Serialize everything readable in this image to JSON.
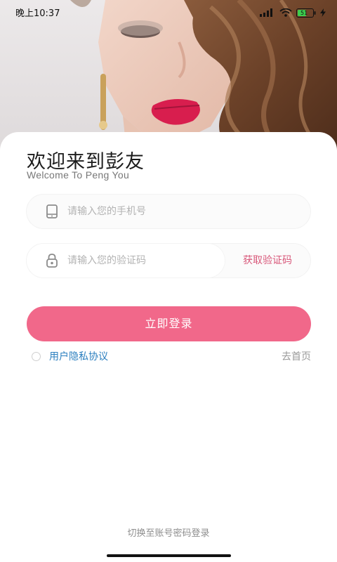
{
  "status_bar": {
    "time": "晚上10:37",
    "battery_level": "51",
    "icons": [
      "signal-icon",
      "wifi-icon",
      "battery-icon",
      "charging-icon"
    ]
  },
  "hero": {
    "image": "portrait-photo"
  },
  "welcome": {
    "title": "欢迎来到彭友",
    "subtitle": "Welcome To Peng You"
  },
  "form": {
    "phone": {
      "icon": "phone-icon",
      "value": "",
      "placeholder": "请输入您的手机号"
    },
    "code": {
      "icon": "lock-icon",
      "value": "",
      "placeholder": "请输入您的验证码",
      "get_code_label": "获取验证码"
    },
    "login_label": "立即登录"
  },
  "agreement": {
    "checked": false,
    "label": "用户隐私协议"
  },
  "go_home_label": "去首页",
  "switch_label": "切换至账号密码登录",
  "colors": {
    "primary": "#f1688a",
    "link": "#2b7fbf",
    "get_code": "#d8587a"
  }
}
